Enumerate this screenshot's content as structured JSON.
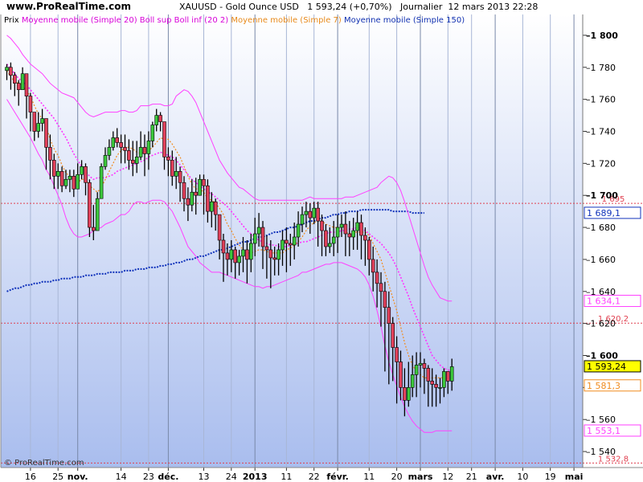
{
  "site": "www.ProRealTime.com",
  "header": {
    "symbol": "XAUUSD - Gold Ounce USD",
    "price": "1 593,24 (+0,70%)",
    "period": "Journalier",
    "datetime": "12 mars 2013 22:28"
  },
  "legend": [
    {
      "label": "Prix",
      "color": "#000000"
    },
    {
      "label": "Moyenne mobile (Simple 20)",
      "color": "#d800d8"
    },
    {
      "label": "Boll sup Boll inf (20 2)",
      "color": "#d800d8"
    },
    {
      "label": "Moyenne mobile (Simple 7)",
      "color": "#e88a1a"
    },
    {
      "label": "Moyenne mobile (Simple 150)",
      "color": "#1030b0"
    }
  ],
  "copyright": "© ProRealTime.com",
  "colors": {
    "background_top": "#ffffff",
    "background_bottom": "#a9bdee",
    "up_candle": "#3cc83c",
    "down_candle": "#e0405a",
    "ma20": "#ff33ff",
    "bollinger": "#ff40ff",
    "ma7": "#f08c20",
    "ma150": "#1133bb",
    "hline": "#e04050"
  },
  "chart_data": {
    "type": "candlestick",
    "y_unit": "USD",
    "ylim": [
      1530,
      1813
    ],
    "y_ticks": [
      1540,
      1560,
      1580,
      1600,
      1620,
      1640,
      1660,
      1680,
      1700,
      1720,
      1740,
      1760,
      1780,
      1800
    ],
    "y_tick_labels": [
      "1 540",
      "1 560",
      "1 580",
      "1 600",
      "1 620",
      "1 640",
      "1 660",
      "1 680",
      "1 700",
      "1 720",
      "1 740",
      "1 760",
      "1 780",
      "1 800"
    ],
    "x_tick_labels": [
      {
        "i": 6,
        "label": "16",
        "bold": false
      },
      {
        "i": 13,
        "label": "25",
        "bold": false
      },
      {
        "i": 18,
        "label": "nov.",
        "bold": true
      },
      {
        "i": 29,
        "label": "14",
        "bold": false
      },
      {
        "i": 36,
        "label": "23",
        "bold": false
      },
      {
        "i": 41,
        "label": "déc.",
        "bold": true
      },
      {
        "i": 50,
        "label": "13",
        "bold": false
      },
      {
        "i": 57,
        "label": "24",
        "bold": false
      },
      {
        "i": 63,
        "label": "2013",
        "bold": true
      },
      {
        "i": 71,
        "label": "11",
        "bold": false
      },
      {
        "i": 78,
        "label": "22",
        "bold": false
      },
      {
        "i": 84,
        "label": "févr.",
        "bold": true
      },
      {
        "i": 92,
        "label": "11",
        "bold": false
      },
      {
        "i": 99,
        "label": "20",
        "bold": false
      },
      {
        "i": 105,
        "label": "mars",
        "bold": true
      },
      {
        "i": 112,
        "label": "12",
        "bold": false
      },
      {
        "i": 118,
        "label": "21",
        "bold": false
      },
      {
        "i": 124,
        "label": "avr.",
        "bold": true
      },
      {
        "i": 131,
        "label": "10",
        "bold": false
      },
      {
        "i": 138,
        "label": "19",
        "bold": false
      },
      {
        "i": 144,
        "label": "mai",
        "bold": true
      }
    ],
    "horizontal_lines": [
      {
        "value": 1695,
        "label": "1 695"
      },
      {
        "value": 1620.2,
        "label": "1 620,2"
      },
      {
        "value": 1532.8,
        "label": "1 532,8"
      }
    ],
    "last_value_boxes": [
      {
        "value": 1689.1,
        "label": "1 689,1",
        "series": "ma150"
      },
      {
        "value": 1634.1,
        "label": "1 634,1",
        "series": "boll_sup"
      },
      {
        "value": 1593.24,
        "label": "1 593,24",
        "series": "price"
      },
      {
        "value": 1581.3,
        "label": "1 581,3",
        "series": "ma7"
      },
      {
        "value": 1553.1,
        "label": "1 553,1",
        "series": "boll_inf"
      }
    ],
    "close": [
      1780,
      1775,
      1770,
      1766,
      1776,
      1762,
      1752,
      1740,
      1745,
      1748,
      1730,
      1722,
      1712,
      1715,
      1706,
      1710,
      1712,
      1704,
      1713,
      1718,
      1708,
      1680,
      1678,
      1698,
      1718,
      1725,
      1730,
      1736,
      1733,
      1730,
      1728,
      1722,
      1720,
      1724,
      1730,
      1726,
      1734,
      1744,
      1750,
      1746,
      1724,
      1722,
      1712,
      1715,
      1708,
      1698,
      1694,
      1702,
      1700,
      1710,
      1706,
      1690,
      1696,
      1688,
      1672,
      1664,
      1660,
      1666,
      1658,
      1662,
      1666,
      1660,
      1670,
      1676,
      1680,
      1668,
      1666,
      1661,
      1660,
      1666,
      1672,
      1670,
      1669,
      1674,
      1682,
      1688,
      1690,
      1686,
      1692,
      1684,
      1678,
      1668,
      1670,
      1674,
      1680,
      1682,
      1676,
      1674,
      1678,
      1683,
      1675,
      1672,
      1660,
      1652,
      1645,
      1640,
      1630,
      1620,
      1605,
      1596,
      1580,
      1572,
      1580,
      1588,
      1594,
      1595,
      1592,
      1584,
      1582,
      1580,
      1580,
      1590,
      1584,
      1593
    ],
    "high": [
      1782,
      1783,
      1777,
      1772,
      1780,
      1775,
      1764,
      1752,
      1752,
      1754,
      1748,
      1738,
      1726,
      1720,
      1718,
      1716,
      1716,
      1716,
      1720,
      1722,
      1720,
      1710,
      1694,
      1702,
      1720,
      1730,
      1735,
      1740,
      1742,
      1738,
      1738,
      1735,
      1734,
      1734,
      1740,
      1738,
      1740,
      1746,
      1754,
      1752,
      1744,
      1730,
      1728,
      1724,
      1718,
      1712,
      1705,
      1710,
      1711,
      1713,
      1713,
      1710,
      1702,
      1698,
      1688,
      1676,
      1670,
      1672,
      1668,
      1666,
      1674,
      1672,
      1676,
      1686,
      1689,
      1684,
      1675,
      1672,
      1668,
      1670,
      1678,
      1680,
      1676,
      1683,
      1690,
      1693,
      1696,
      1695,
      1696,
      1696,
      1688,
      1682,
      1680,
      1684,
      1688,
      1688,
      1690,
      1684,
      1686,
      1690,
      1688,
      1680,
      1674,
      1668,
      1660,
      1652,
      1646,
      1640,
      1624,
      1612,
      1603,
      1592,
      1596,
      1600,
      1602,
      1602,
      1598,
      1594,
      1592,
      1588,
      1586,
      1592,
      1590,
      1598
    ],
    "low": [
      1772,
      1766,
      1762,
      1756,
      1766,
      1748,
      1740,
      1734,
      1736,
      1740,
      1716,
      1710,
      1704,
      1704,
      1702,
      1704,
      1702,
      1699,
      1704,
      1710,
      1700,
      1674,
      1672,
      1680,
      1704,
      1716,
      1722,
      1728,
      1730,
      1720,
      1720,
      1716,
      1712,
      1714,
      1722,
      1712,
      1716,
      1730,
      1740,
      1740,
      1716,
      1712,
      1706,
      1704,
      1696,
      1690,
      1684,
      1690,
      1688,
      1700,
      1688,
      1683,
      1680,
      1678,
      1660,
      1646,
      1650,
      1652,
      1648,
      1650,
      1652,
      1645,
      1652,
      1662,
      1668,
      1654,
      1648,
      1642,
      1650,
      1650,
      1656,
      1652,
      1656,
      1660,
      1668,
      1677,
      1680,
      1676,
      1682,
      1668,
      1662,
      1662,
      1664,
      1662,
      1664,
      1674,
      1662,
      1662,
      1666,
      1666,
      1660,
      1656,
      1650,
      1640,
      1630,
      1618,
      1590,
      1582,
      1584,
      1570,
      1572,
      1562,
      1568,
      1574,
      1574,
      1580,
      1576,
      1568,
      1568,
      1568,
      1570,
      1574,
      1576,
      1578
    ],
    "ma7": [
      1778,
      1774,
      1771,
      1770,
      1769,
      1765,
      1762,
      1756,
      1751,
      1748,
      1743,
      1735,
      1729,
      1725,
      1719,
      1714,
      1712,
      1710,
      1708,
      1710,
      1710,
      1706,
      1704,
      1702,
      1705,
      1710,
      1715,
      1720,
      1725,
      1728,
      1730,
      1730,
      1729,
      1727,
      1726,
      1727,
      1728,
      1730,
      1733,
      1736,
      1735,
      1735,
      1732,
      1728,
      1724,
      1718,
      1712,
      1707,
      1704,
      1704,
      1702,
      1698,
      1697,
      1695,
      1692,
      1688,
      1682,
      1678,
      1673,
      1669,
      1666,
      1664,
      1664,
      1665,
      1666,
      1666,
      1665,
      1664,
      1664,
      1664,
      1664,
      1666,
      1667,
      1669,
      1671,
      1674,
      1678,
      1681,
      1683,
      1684,
      1684,
      1682,
      1681,
      1680,
      1680,
      1679,
      1677,
      1676,
      1677,
      1677,
      1677,
      1677,
      1675,
      1670,
      1665,
      1660,
      1652,
      1644,
      1636,
      1628,
      1618,
      1608,
      1600,
      1594,
      1590,
      1588,
      1586,
      1586,
      1586,
      1586,
      1586,
      1586,
      1585,
      1586
    ],
    "ma20": [
      1782,
      1779,
      1776,
      1773,
      1771,
      1769,
      1766,
      1763,
      1760,
      1757,
      1754,
      1751,
      1748,
      1744,
      1740,
      1736,
      1731,
      1726,
      1722,
      1718,
      1715,
      1712,
      1710,
      1711,
      1711,
      1711,
      1712,
      1713,
      1715,
      1716,
      1717,
      1718,
      1719,
      1720,
      1721,
      1722,
      1724,
      1725,
      1726,
      1727,
      1726,
      1725,
      1724,
      1722,
      1719,
      1716,
      1713,
      1710,
      1708,
      1706,
      1704,
      1702,
      1701,
      1699,
      1697,
      1695,
      1693,
      1690,
      1687,
      1684,
      1681,
      1678,
      1676,
      1674,
      1672,
      1671,
      1670,
      1669,
      1669,
      1668,
      1668,
      1668,
      1669,
      1670,
      1670,
      1671,
      1671,
      1672,
      1673,
      1674,
      1675,
      1676,
      1677,
      1677,
      1677,
      1678,
      1678,
      1679,
      1679,
      1680,
      1679,
      1678,
      1676,
      1674,
      1672,
      1670,
      1667,
      1664,
      1660,
      1655,
      1649,
      1643,
      1637,
      1630,
      1624,
      1618,
      1612,
      1606,
      1600,
      1597,
      1594,
      1592,
      1591,
      1590
    ],
    "boll_sup": [
      1800,
      1798,
      1795,
      1792,
      1788,
      1785,
      1782,
      1780,
      1778,
      1776,
      1773,
      1770,
      1768,
      1766,
      1764,
      1763,
      1762,
      1761,
      1758,
      1755,
      1752,
      1750,
      1749,
      1750,
      1751,
      1752,
      1752,
      1752,
      1752,
      1753,
      1753,
      1752,
      1752,
      1753,
      1756,
      1756,
      1756,
      1757,
      1757,
      1757,
      1756,
      1756,
      1757,
      1762,
      1764,
      1766,
      1765,
      1762,
      1758,
      1752,
      1746,
      1740,
      1734,
      1728,
      1722,
      1718,
      1714,
      1711,
      1708,
      1705,
      1704,
      1702,
      1700,
      1698,
      1697,
      1697,
      1697,
      1697,
      1697,
      1697,
      1697,
      1697,
      1697,
      1697,
      1697,
      1697,
      1698,
      1699,
      1698,
      1698,
      1698,
      1698,
      1698,
      1698,
      1698,
      1698,
      1699,
      1699,
      1699,
      1700,
      1701,
      1702,
      1703,
      1704,
      1705,
      1708,
      1710,
      1712,
      1711,
      1708,
      1703,
      1696,
      1688,
      1680,
      1672,
      1664,
      1656,
      1649,
      1644,
      1640,
      1636,
      1635,
      1634,
      1634
    ],
    "boll_inf": [
      1760,
      1756,
      1752,
      1748,
      1744,
      1740,
      1736,
      1731,
      1726,
      1722,
      1716,
      1712,
      1706,
      1700,
      1694,
      1686,
      1680,
      1676,
      1674,
      1674,
      1675,
      1676,
      1678,
      1679,
      1680,
      1682,
      1683,
      1684,
      1686,
      1688,
      1688,
      1690,
      1694,
      1696,
      1696,
      1695,
      1696,
      1697,
      1697,
      1697,
      1696,
      1693,
      1690,
      1685,
      1680,
      1674,
      1668,
      1665,
      1662,
      1658,
      1656,
      1654,
      1652,
      1652,
      1652,
      1651,
      1650,
      1649,
      1648,
      1647,
      1646,
      1645,
      1644,
      1643,
      1643,
      1642,
      1643,
      1643,
      1644,
      1645,
      1646,
      1647,
      1648,
      1649,
      1650,
      1652,
      1652,
      1653,
      1654,
      1655,
      1656,
      1657,
      1657,
      1658,
      1658,
      1658,
      1657,
      1656,
      1655,
      1654,
      1652,
      1649,
      1644,
      1637,
      1628,
      1618,
      1606,
      1596,
      1588,
      1581,
      1574,
      1568,
      1563,
      1559,
      1556,
      1554,
      1552,
      1552,
      1552,
      1553,
      1553,
      1553,
      1553,
      1553
    ],
    "ma150_start_index": 0,
    "ma150": [
      1640,
      1641,
      1642,
      1642,
      1643,
      1644,
      1644,
      1645,
      1645,
      1646,
      1646,
      1646,
      1647,
      1647,
      1648,
      1648,
      1648,
      1649,
      1649,
      1649,
      1650,
      1650,
      1650,
      1651,
      1651,
      1651,
      1652,
      1652,
      1652,
      1652,
      1653,
      1653,
      1653,
      1654,
      1654,
      1654,
      1655,
      1655,
      1655,
      1656,
      1656,
      1657,
      1657,
      1658,
      1658,
      1659,
      1660,
      1660,
      1661,
      1662,
      1662,
      1663,
      1664,
      1665,
      1666,
      1666,
      1667,
      1668,
      1669,
      1670,
      1671,
      1671,
      1672,
      1673,
      1674,
      1674,
      1675,
      1676,
      1677,
      1677,
      1678,
      1679,
      1680,
      1680,
      1681,
      1682,
      1683,
      1684,
      1684,
      1685,
      1686,
      1686,
      1687,
      1688,
      1688,
      1689,
      1689,
      1690,
      1690,
      1690,
      1691,
      1691,
      1691,
      1691,
      1691,
      1691,
      1691,
      1691,
      1690,
      1690,
      1690,
      1690,
      1690,
      1689,
      1689,
      1689,
      1689
    ]
  }
}
